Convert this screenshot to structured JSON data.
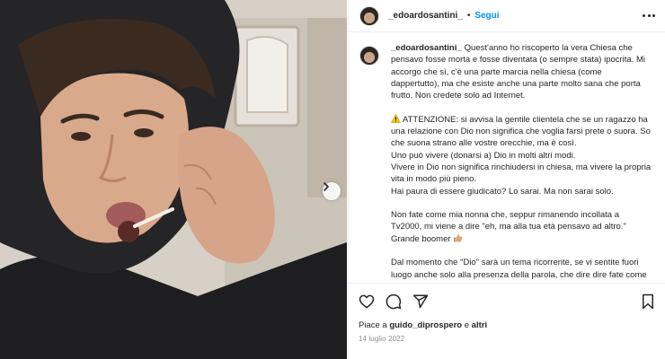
{
  "post": {
    "author": "_edoardosantini_",
    "follow_label": "Segui",
    "dot": "•",
    "caption": [
      "Quest'anno ho riscoperto la vera Chiesa che pensavo fosse morta e fosse diventata (o sempre stata) ipocrita. Mi accorgo che sì, c'è una parte marcia nella chiesa (come dappertutto), ma che esiste anche una parte molto sana che porta frutto. Non credete solo ad Internet.",
      "ATTENZIONE: si avvisa la gentile clientela che se un ragazzo ha una relazione con Dio non significa che voglia farsi prete o suora. So che suona strano alle vostre orecchie, ma è così.",
      "Uno può vivere (donarsi a) Dio in molti altri modi.",
      "Vivere in Dio non significa rinchiudersi in chiesa, ma vivere la propria vita in modo più pieno.",
      "Hai paura di essere giudicato? Lo sarai. Ma non sarai solo.",
      "Non fate come mia nonna che, seppur rimanendo incollata a Tv2000, mi viene a dire \"eh, ma alla tua età pensavo ad altro.\" Grande boomer",
      "Dal momento che \"Dio\" sarà un tema ricorrente, se vi sentite fuori luogo anche solo alla presenza della parola, che dire dire fate come volete, ma chiedo solo rispetto."
    ],
    "likes_prefix": "Piace a",
    "likes_user": "guido_diprospero",
    "likes_conjunction": "e",
    "likes_suffix": "altri",
    "date": "14 luglio 2022"
  },
  "icons": {
    "like": "heart-icon",
    "comment": "comment-icon",
    "share": "share-icon",
    "save": "bookmark-icon",
    "more": "more-icon",
    "next": "chevron-right-icon",
    "warning": "warning-emoji",
    "thumbs_up": "thumbs-up-emoji"
  },
  "colors": {
    "link": "#0095f6",
    "text": "#262626",
    "muted": "#8e8e8e",
    "divider": "#efefef"
  }
}
